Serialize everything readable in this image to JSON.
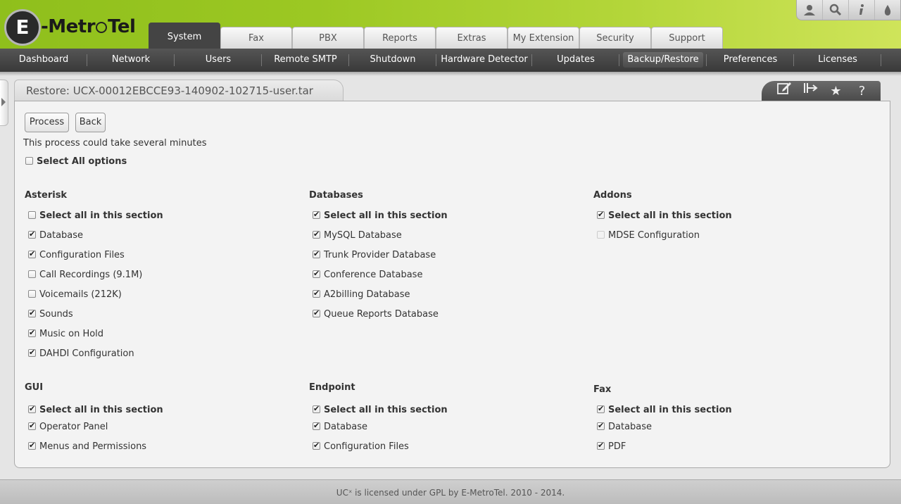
{
  "brand": {
    "logo_letter": "E",
    "logo_word_a": "-Metr",
    "logo_word_b": "Tel"
  },
  "top_icons": [
    "user-icon",
    "search-icon",
    "info-icon",
    "drop-icon"
  ],
  "main_tabs": [
    "System",
    "Fax",
    "PBX",
    "Reports",
    "Extras",
    "My Extension",
    "Security",
    "Support"
  ],
  "active_main_tab": "System",
  "sub_nav": [
    "Dashboard",
    "Network",
    "Users",
    "Remote SMTP",
    "Shutdown",
    "Hardware Detector",
    "Updates",
    "Backup/Restore",
    "Preferences",
    "Licenses"
  ],
  "active_sub_nav": "Backup/Restore",
  "page_title": "Restore: UCX-00012EBCCE93-140902-102715-user.tar",
  "title_icons": [
    "edit-icon",
    "export-icon",
    "star-icon",
    "help-icon"
  ],
  "buttons": {
    "process": "Process",
    "back": "Back"
  },
  "note": "This process could take several minutes",
  "select_all_options": {
    "label": "Select All options",
    "checked": false
  },
  "sections": [
    {
      "title": "Asterisk",
      "select_all": {
        "label": "Select all in this section",
        "checked": false
      },
      "items": [
        {
          "label": "Database",
          "checked": true
        },
        {
          "label": "Configuration Files",
          "checked": true
        },
        {
          "label": "Call Recordings (9.1M)",
          "checked": false
        },
        {
          "label": "Voicemails (212K)",
          "checked": false
        },
        {
          "label": "Sounds",
          "checked": true
        },
        {
          "label": "Music on Hold",
          "checked": true
        },
        {
          "label": "DAHDI Configuration",
          "checked": true
        }
      ]
    },
    {
      "title": "Databases",
      "select_all": {
        "label": "Select all in this section",
        "checked": true
      },
      "items": [
        {
          "label": "MySQL Database",
          "checked": true
        },
        {
          "label": "Trunk Provider Database",
          "checked": true
        },
        {
          "label": "Conference Database",
          "checked": true
        },
        {
          "label": "A2billing Database",
          "checked": true
        },
        {
          "label": "Queue Reports Database",
          "checked": true
        }
      ]
    },
    {
      "title": "Addons",
      "select_all": {
        "label": "Select all in this section",
        "checked": true
      },
      "items": [
        {
          "label": "MDSE Configuration",
          "checked": false,
          "disabled": true
        }
      ]
    },
    {
      "title": "GUI",
      "select_all": {
        "label": "Select all in this section",
        "checked": true
      },
      "items": [
        {
          "label": "Operator Panel",
          "checked": true
        },
        {
          "label": "Menus and Permissions",
          "checked": true
        }
      ]
    },
    {
      "title": "Endpoint",
      "select_all": {
        "label": "Select all in this section",
        "checked": true
      },
      "items": [
        {
          "label": "Database",
          "checked": true
        },
        {
          "label": "Configuration Files",
          "checked": true
        }
      ]
    },
    {
      "title": "Fax",
      "select_all": {
        "label": "Select all in this section",
        "checked": true
      },
      "items": [
        {
          "label": "Database",
          "checked": true
        },
        {
          "label": "PDF",
          "checked": true
        }
      ]
    }
  ],
  "footer": "UCˣ is licensed under GPL by E-MetroTel. 2010 - 2014."
}
